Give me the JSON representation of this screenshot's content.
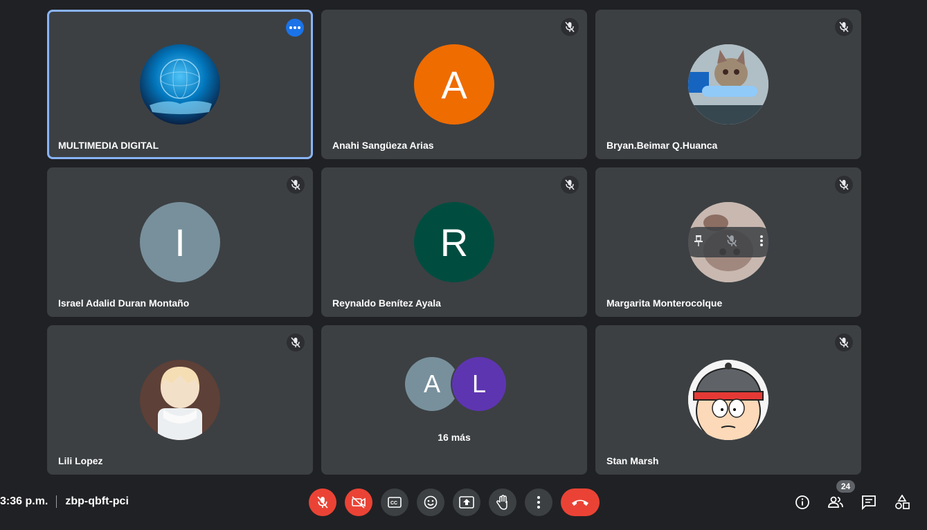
{
  "tiles": [
    {
      "name": "MULTIMEDIA DIGITAL",
      "avatar": "globe-hand-image"
    },
    {
      "name": "Anahi Sangüeza Arias",
      "initial": "A",
      "color": "#ef6c00"
    },
    {
      "name": "Bryan.Beimar Q.Huanca",
      "avatar": "cat-photo"
    },
    {
      "name": "Israel Adalid Duran Montaño",
      "initial": "I",
      "color": "#78909c"
    },
    {
      "name": "Reynaldo Benítez Ayala",
      "initial": "R",
      "color": "#004d40"
    },
    {
      "name": "Margarita Monterocolque",
      "avatar": "cat-photo"
    },
    {
      "name": "Lili Lopez",
      "avatar": "anime-character"
    },
    {
      "more": {
        "initials": [
          "A",
          "L"
        ],
        "colors": [
          "#78909c",
          "#5e35b1"
        ],
        "label": "16 más"
      }
    },
    {
      "name": "Stan Marsh",
      "avatar": "cartoon-character"
    }
  ],
  "footer": {
    "time": "3:36 p.m.",
    "meeting_code": "zbp-qbft-pci",
    "participants_count": "24"
  },
  "controls": [
    "mic-off-icon",
    "camera-off-icon",
    "captions-icon",
    "emoji-icon",
    "present-icon",
    "raise-hand-icon",
    "more-options-icon",
    "end-call-icon"
  ],
  "right_icons": [
    "info-icon",
    "people-icon",
    "chat-icon",
    "activities-icon"
  ]
}
